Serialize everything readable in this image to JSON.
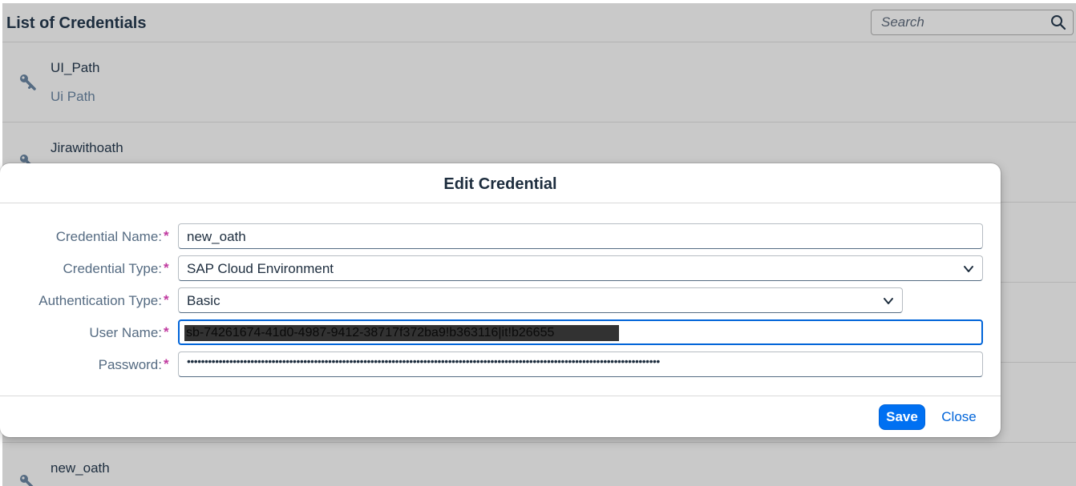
{
  "header": {
    "title": "List of Credentials",
    "search_placeholder": "Search"
  },
  "list": {
    "items": [
      {
        "title": "UI_Path",
        "description": "Ui Path",
        "icon": "key-icon"
      },
      {
        "title": "Jirawithoath",
        "description": "",
        "icon": "key-icon"
      }
    ],
    "last_item": {
      "title": "new_oath",
      "icon": "key-icon"
    }
  },
  "dialog": {
    "title": "Edit Credential",
    "fields": {
      "credential_name": {
        "label": "Credential Name:",
        "value": "new_oath"
      },
      "credential_type": {
        "label": "Credential Type:",
        "value": "SAP Cloud Environment"
      },
      "authentication_type": {
        "label": "Authentication Type:",
        "value": "Basic"
      },
      "user_name": {
        "label": "User Name:",
        "value": "sb-74261674-41d0-4987-9412-38717f372ba9!b363116|it!b26655"
      },
      "password": {
        "label": "Password:",
        "value": "••••••••••••••••••••••••••••••••••••••••••••••••••••••••••••••••••••••••••••••••••••••••••••••••••••••••••••••••••••••••••••••••••••••"
      }
    },
    "required_marker": "*",
    "save_label": "Save",
    "close_label": "Close"
  },
  "colors": {
    "accent": "#0070f2",
    "required": "#c0399f",
    "label": "#556b82",
    "backdrop": "#c9c9c9"
  }
}
